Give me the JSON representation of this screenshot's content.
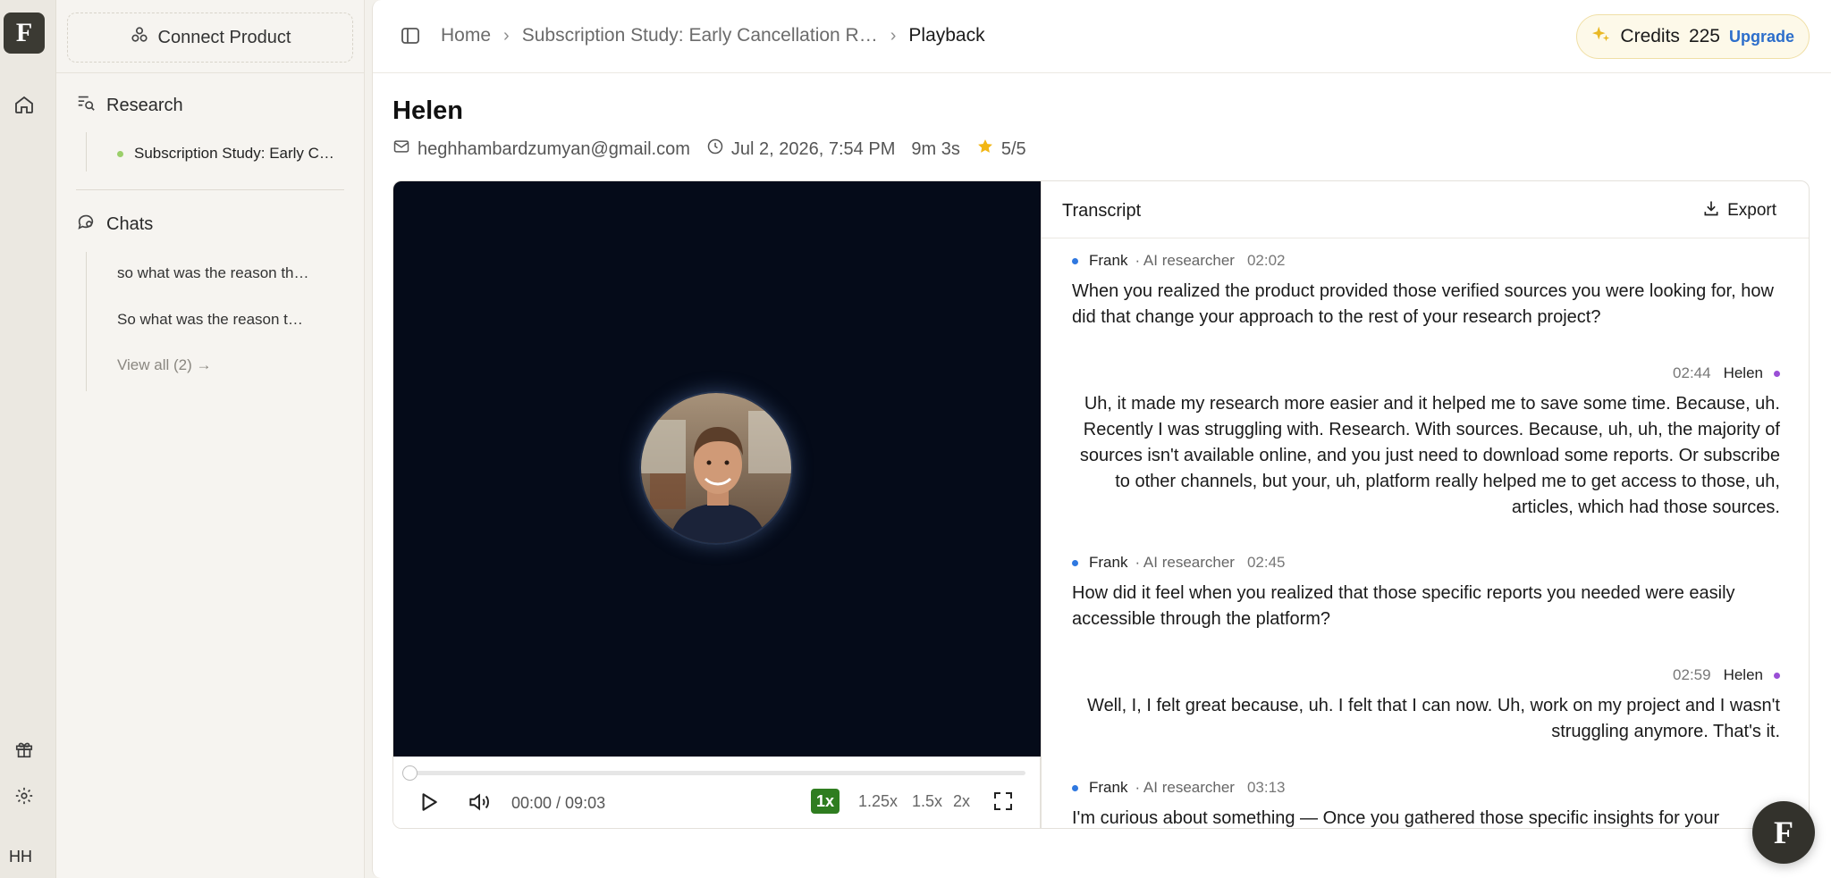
{
  "brand": {
    "logo_letter": "F"
  },
  "rail": {
    "user_initials": "HH"
  },
  "sidebar": {
    "connect_label": "Connect Product",
    "research_heading": "Research",
    "research_items": [
      "Subscription Study: Early C…"
    ],
    "chats_heading": "Chats",
    "chat_items": [
      "so what was the reason th…",
      "So what was the reason t…"
    ],
    "view_all": "View all (2) →"
  },
  "topbar": {
    "breadcrumb": [
      "Home",
      "Subscription Study: Early Cancellation R…",
      "Playback"
    ],
    "credits_label": "Credits",
    "credits_value": "225",
    "upgrade_label": "Upgrade"
  },
  "session": {
    "name": "Helen",
    "email": "heghhambardzumyan@gmail.com",
    "datetime": "Jul 2, 2026, 7:54 PM",
    "duration": "9m 3s",
    "rating": "5/5"
  },
  "player": {
    "timecode": "00:00 / 09:03",
    "progress": 0,
    "speeds": [
      "1x",
      "1.25x",
      "1.5x",
      "2x"
    ],
    "active_speed": "1x"
  },
  "transcript": {
    "title": "Transcript",
    "export_label": "Export",
    "messages": [
      {
        "speaker": "Frank",
        "role": "· AI researcher",
        "time": "02:02",
        "text": "When you realized the product provided those verified sources you were looking for, how did that change your approach to the rest of your research project?"
      },
      {
        "speaker": "Helen",
        "role": "",
        "time": "02:44",
        "text": "Uh, it made my research more easier and it helped me to save some time. Because, uh. Recently I was struggling with. Research. With sources. Because, uh, uh, the majority of sources isn't available online, and you just need to download some reports. Or subscribe to other channels, but your, uh, platform really helped me to get access to those, uh, articles, which had those sources."
      },
      {
        "speaker": "Frank",
        "role": "· AI researcher",
        "time": "02:45",
        "text": "How did it feel when you realized that those specific reports you needed were easily accessible through the platform?"
      },
      {
        "speaker": "Helen",
        "role": "",
        "time": "02:59",
        "text": "Well, I, I felt great because, uh. I felt that I can now. Uh, work on my project and I wasn't struggling anymore. That's it."
      },
      {
        "speaker": "Frank",
        "role": "· AI researcher",
        "time": "03:13",
        "text": "I'm curious about something — Once you gathered those specific insights for your"
      }
    ]
  },
  "colors": {
    "accent_green": "#2f7d20",
    "frank_dot": "#2f78e0",
    "helen_dot": "#9a4fd6",
    "link_blue": "#2c6ecb"
  },
  "icons": {
    "research": "search-list-icon",
    "chats": "chat-bubble-icon",
    "home": "home-icon",
    "gift": "gift-icon",
    "settings": "gear-icon",
    "connect": "nodes-icon"
  }
}
